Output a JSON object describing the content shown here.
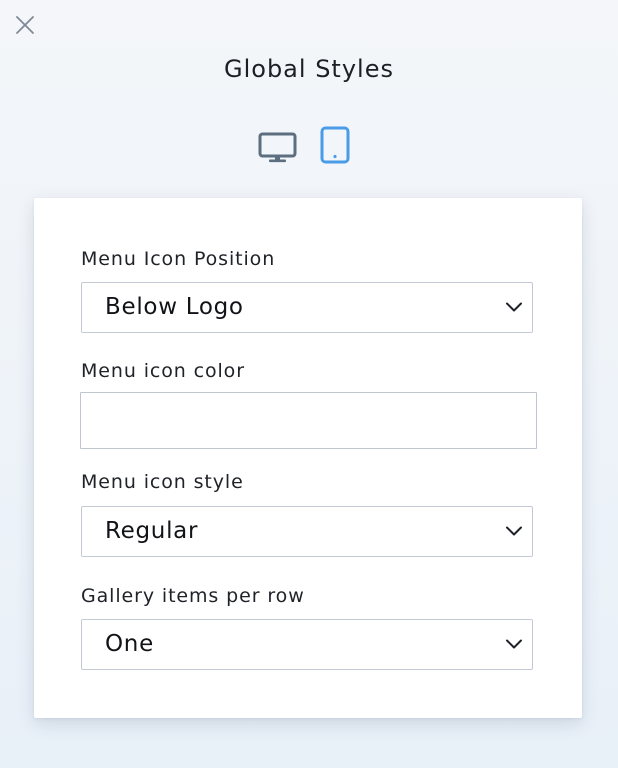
{
  "header": {
    "title": "Global Styles"
  },
  "icons": {
    "close": "close-icon",
    "desktop": "desktop-monitor-icon",
    "tablet": "tablet-icon",
    "chevron": "chevron-down-icon"
  },
  "colors": {
    "active_device": "#4a9ce8",
    "inactive_device": "#5c6e80",
    "close_icon": "#7e8a97"
  },
  "device_switch": {
    "selected": "tablet"
  },
  "form": {
    "menu_icon_position": {
      "label": "Menu Icon Position",
      "value": "Below Logo"
    },
    "menu_icon_color": {
      "label": "Menu icon color",
      "value": ""
    },
    "menu_icon_style": {
      "label": "Menu icon style",
      "value": "Regular"
    },
    "gallery_items_per_row": {
      "label": "Gallery items per row",
      "value": "One"
    }
  }
}
